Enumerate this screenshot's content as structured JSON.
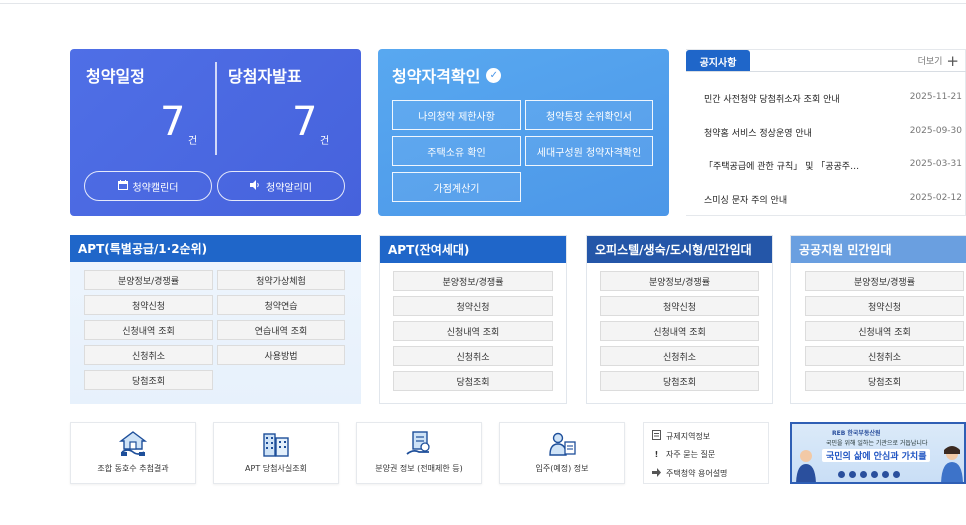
{
  "schedule": {
    "left_title": "청약일정",
    "left_count": "7",
    "left_unit": "건",
    "right_title": "당첨자발표",
    "right_count": "7",
    "right_unit": "건",
    "calendar_label": "청약캘린더",
    "alarm_label": "청약알리미"
  },
  "qualification": {
    "title": "청약자격확인",
    "buttons": [
      "나의청약 제한사항",
      "청약통장 순위확인서",
      "주택소유 확인",
      "세대구성원 청약자격확인",
      "가점계산기"
    ]
  },
  "notice": {
    "tab": "공지사항",
    "more": "더보기",
    "items": [
      {
        "title": "민간 사전청약 당첨취소자 조회 안내",
        "date": "2025-11-21"
      },
      {
        "title": "청약홈 서비스 정상운영 안내",
        "date": "2025-09-30"
      },
      {
        "title": "「주택공급에 관한 규칙」 및 「공공주…",
        "date": "2025-03-31"
      },
      {
        "title": "스미싱 문자 주의 안내",
        "date": "2025-02-12"
      }
    ]
  },
  "categories": [
    {
      "title": "APT(특별공급/1·2순위)",
      "color": "#1f66c9",
      "items": [
        "분양정보/경쟁률",
        "청약가상체험",
        "청약신청",
        "청약연습",
        "신청내역 조회",
        "연습내역 조회",
        "신청취소",
        "사용방법",
        "당첨조회"
      ]
    },
    {
      "title": "APT(잔여세대)",
      "color": "#1f66c9",
      "items": [
        "분양정보/경쟁률",
        "청약신청",
        "신청내역 조회",
        "신청취소",
        "당첨조회"
      ]
    },
    {
      "title": "오피스텔/생숙/도시형/민간임대",
      "color": "#2456a8",
      "items": [
        "분양정보/경쟁률",
        "청약신청",
        "신청내역 조회",
        "신청취소",
        "당첨조회"
      ]
    },
    {
      "title": "공공지원 민간임대",
      "color": "#6a9fe0",
      "items": [
        "분양정보/경쟁률",
        "청약신청",
        "신청내역 조회",
        "신청취소",
        "당첨조회"
      ]
    }
  ],
  "quicklinks": [
    {
      "label": "조합 동호수 추첨결과",
      "icon": "handshake-house-icon"
    },
    {
      "label": "APT 당첨사실조회",
      "icon": "apartment-building-icon"
    },
    {
      "label": "분양권 정보 (전매제한 등)",
      "icon": "document-hand-icon"
    },
    {
      "label": "입주(예정) 정보",
      "icon": "resident-id-icon"
    }
  ],
  "mini_links": [
    {
      "label": "규제지역정보",
      "icon": "document-icon"
    },
    {
      "label": "자주 묻는 질문",
      "icon": "exclamation-icon"
    },
    {
      "label": "주택청약 용어설명",
      "icon": "arrow-right-icon"
    }
  ],
  "banner": {
    "logo": "REB 한국부동산원",
    "subtitle": "국민을 위해 일하는 기관으로 거듭납니다",
    "headline": "국민의 삶에 안심과 가치를"
  },
  "colors": {
    "schedule_bg": "#4f6fe6",
    "qualification_bg": "#58a8f0",
    "primary": "#1f66c9"
  }
}
